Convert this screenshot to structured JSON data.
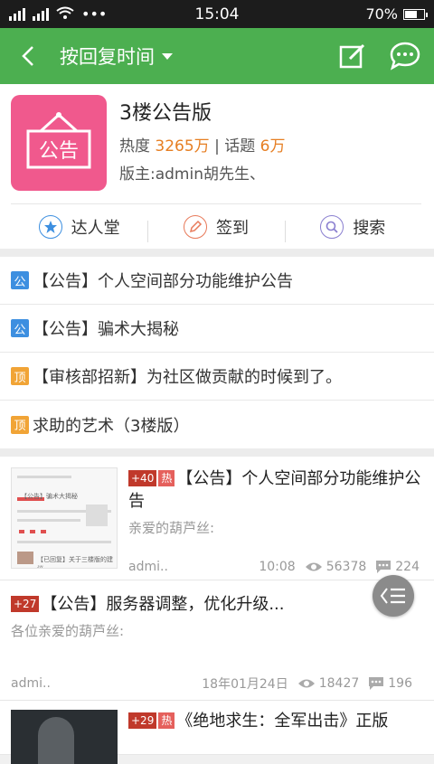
{
  "status": {
    "time": "15:04",
    "battery": "70%",
    "battery_level": 0.7,
    "dots": "•••"
  },
  "nav": {
    "title": "按回复时间"
  },
  "board": {
    "name": "3楼公告版",
    "icon_text": "公告",
    "heat_label": "热度",
    "heat_value": "3265万",
    "sep": "|",
    "topics_label": "话题",
    "topics_value": "6万",
    "moderator": "版主:admin胡先生、"
  },
  "actions": [
    {
      "label": "达人堂",
      "color": "#3d8fe0"
    },
    {
      "label": "签到",
      "color": "#e87a5a"
    },
    {
      "label": "搜索",
      "color": "#8a7fd0"
    }
  ],
  "notices": [
    {
      "tag": "公",
      "text": "【公告】个人空间部分功能维护公告"
    },
    {
      "tag": "公",
      "text": "【公告】骗术大揭秘"
    },
    {
      "tag": "顶",
      "text": "【审核部招新】为社区做贡献的时候到了。"
    },
    {
      "tag": "顶",
      "text": "求助的艺术（3楼版）"
    }
  ],
  "posts": [
    {
      "plus": "+40",
      "hot": "热",
      "title": "【公告】个人空间部分功能维护公告",
      "desc": "亲爱的葫芦丝:",
      "author": "admi..",
      "time": "10:08",
      "views": "56378",
      "comments": "224",
      "thumb_text_1": "【公告】骗术大揭秘",
      "thumb_text_2": "【已回复】关于三楼版的建议"
    },
    {
      "plus": "+27",
      "title": "【公告】服务器调整，优化升级...",
      "desc": "各位亲爱的葫芦丝:",
      "author": "admi..",
      "time": "18年01月24日",
      "views": "18427",
      "comments": "196"
    },
    {
      "plus": "+29",
      "hot": "热",
      "title": "《绝地求生：全军出击》正版"
    }
  ],
  "colors": {
    "nav": "#4caf50",
    "accent": "#e67e22",
    "board_icon": "#f0598d"
  }
}
